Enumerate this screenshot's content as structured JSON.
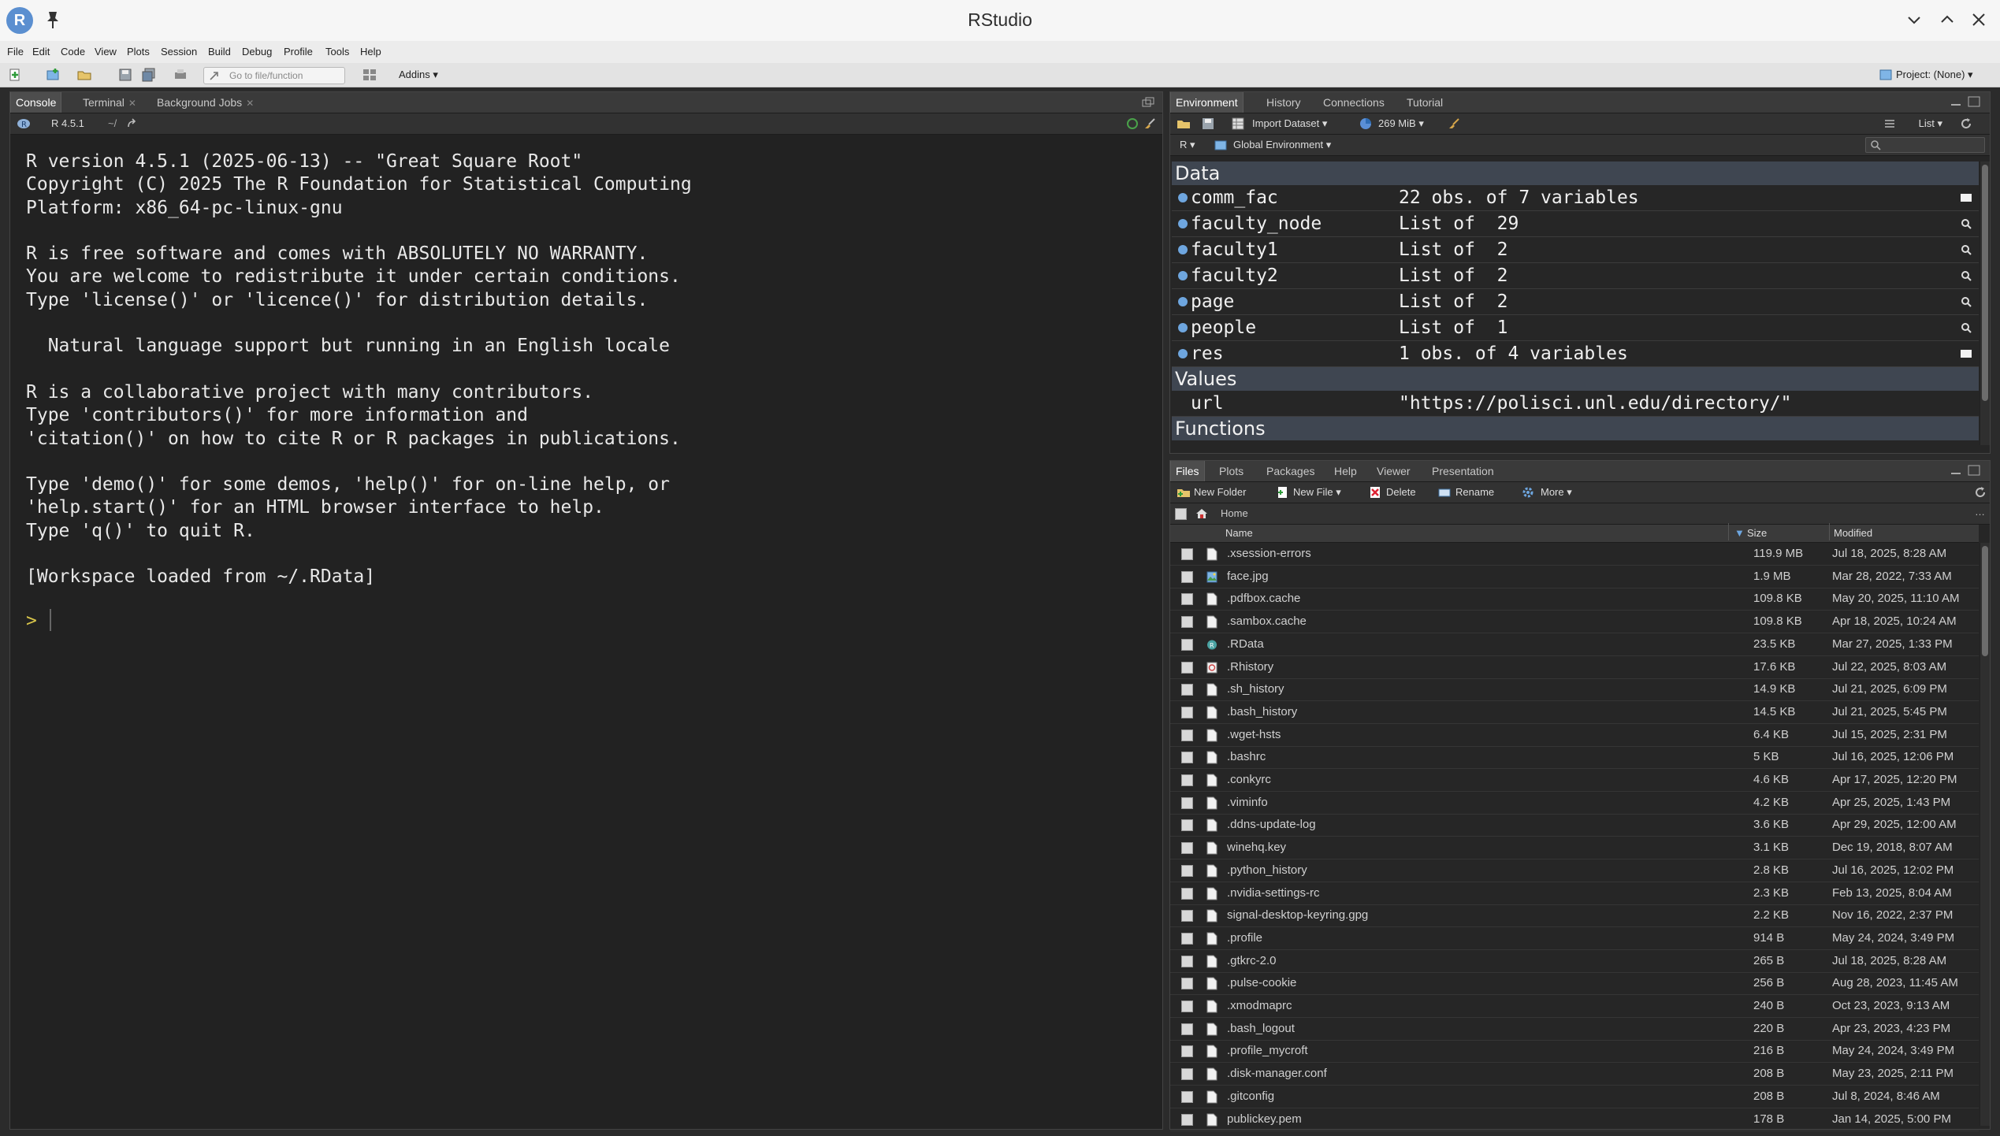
{
  "window": {
    "title": "RStudio",
    "logo_letter": "R"
  },
  "menu": [
    "File",
    "Edit",
    "Code",
    "View",
    "Plots",
    "Session",
    "Build",
    "Debug",
    "Profile",
    "Tools",
    "Help"
  ],
  "toolbar": {
    "goto_placeholder": "Go to file/function",
    "addins": "Addins",
    "project": "Project: (None)"
  },
  "left_pane": {
    "tabs": [
      "Console",
      "Terminal",
      "Background Jobs"
    ],
    "r_version": "R 4.5.1",
    "path": "~/",
    "console_text": "R version 4.5.1 (2025-06-13) -- \"Great Square Root\"\nCopyright (C) 2025 The R Foundation for Statistical Computing\nPlatform: x86_64-pc-linux-gnu\n\nR is free software and comes with ABSOLUTELY NO WARRANTY.\nYou are welcome to redistribute it under certain conditions.\nType 'license()' or 'licence()' for distribution details.\n\n  Natural language support but running in an English locale\n\nR is a collaborative project with many contributors.\nType 'contributors()' for more information and\n'citation()' on how to cite R or R packages in publications.\n\nType 'demo()' for some demos, 'help()' for on-line help, or\n'help.start()' for an HTML browser interface to help.\nType 'q()' to quit R.\n\n[Workspace loaded from ~/.RData]",
    "prompt": ">"
  },
  "env_pane": {
    "tabs": [
      "Environment",
      "History",
      "Connections",
      "Tutorial"
    ],
    "import_dataset": "Import Dataset",
    "memory": "269 MiB",
    "view_mode": "List",
    "language": "R",
    "scope": "Global Environment",
    "sections": {
      "data": "Data",
      "values": "Values",
      "functions": "Functions"
    },
    "data_rows": [
      {
        "name": "comm_fac",
        "value": "22 obs. of 7 variables",
        "action": "grid"
      },
      {
        "name": "faculty_node",
        "value": "List of  29",
        "action": "search"
      },
      {
        "name": "faculty1",
        "value": "List of  2",
        "action": "search"
      },
      {
        "name": "faculty2",
        "value": "List of  2",
        "action": "search"
      },
      {
        "name": "page",
        "value": "List of  2",
        "action": "search"
      },
      {
        "name": "people",
        "value": "List of  1",
        "action": "search"
      },
      {
        "name": "res",
        "value": "1 obs. of 4 variables",
        "action": "grid"
      }
    ],
    "value_rows": [
      {
        "name": "url",
        "value": "\"https://polisci.unl.edu/directory/\""
      }
    ]
  },
  "files_pane": {
    "tabs": [
      "Files",
      "Plots",
      "Packages",
      "Help",
      "Viewer",
      "Presentation"
    ],
    "actions": {
      "new_folder": "New Folder",
      "new_file": "New File",
      "delete": "Delete",
      "rename": "Rename",
      "more": "More"
    },
    "breadcrumb": "Home",
    "columns": {
      "name": "Name",
      "size": "Size",
      "modified": "Modified"
    },
    "files": [
      {
        "name": ".xsession-errors",
        "size": "119.9 MB",
        "modified": "Jul 18, 2025, 8:28 AM",
        "icon": "file"
      },
      {
        "name": "face.jpg",
        "size": "1.9 MB",
        "modified": "Mar 28, 2022, 7:33 AM",
        "icon": "image"
      },
      {
        "name": ".pdfbox.cache",
        "size": "109.8 KB",
        "modified": "May 20, 2025, 11:10 AM",
        "icon": "file"
      },
      {
        "name": ".sambox.cache",
        "size": "109.8 KB",
        "modified": "Apr 18, 2025, 10:24 AM",
        "icon": "file"
      },
      {
        "name": ".RData",
        "size": "23.5 KB",
        "modified": "Mar 27, 2025, 1:33 PM",
        "icon": "rdata"
      },
      {
        "name": ".Rhistory",
        "size": "17.6 KB",
        "modified": "Jul 22, 2025, 8:03 AM",
        "icon": "rhistory"
      },
      {
        "name": ".sh_history",
        "size": "14.9 KB",
        "modified": "Jul 21, 2025, 6:09 PM",
        "icon": "file"
      },
      {
        "name": ".bash_history",
        "size": "14.5 KB",
        "modified": "Jul 21, 2025, 5:45 PM",
        "icon": "file"
      },
      {
        "name": ".wget-hsts",
        "size": "6.4 KB",
        "modified": "Jul 15, 2025, 2:31 PM",
        "icon": "file"
      },
      {
        "name": ".bashrc",
        "size": "5 KB",
        "modified": "Jul 16, 2025, 12:06 PM",
        "icon": "file"
      },
      {
        "name": ".conkyrc",
        "size": "4.6 KB",
        "modified": "Apr 17, 2025, 12:20 PM",
        "icon": "file"
      },
      {
        "name": ".viminfo",
        "size": "4.2 KB",
        "modified": "Apr 25, 2025, 1:43 PM",
        "icon": "file"
      },
      {
        "name": ".ddns-update-log",
        "size": "3.6 KB",
        "modified": "Apr 29, 2025, 12:00 AM",
        "icon": "file"
      },
      {
        "name": "winehq.key",
        "size": "3.1 KB",
        "modified": "Dec 19, 2018, 8:07 AM",
        "icon": "file"
      },
      {
        "name": ".python_history",
        "size": "2.8 KB",
        "modified": "Jul 16, 2025, 12:02 PM",
        "icon": "file"
      },
      {
        "name": ".nvidia-settings-rc",
        "size": "2.3 KB",
        "modified": "Feb 13, 2025, 8:04 AM",
        "icon": "file"
      },
      {
        "name": "signal-desktop-keyring.gpg",
        "size": "2.2 KB",
        "modified": "Nov 16, 2022, 2:37 PM",
        "icon": "file"
      },
      {
        "name": ".profile",
        "size": "914 B",
        "modified": "May 24, 2024, 3:49 PM",
        "icon": "file"
      },
      {
        "name": ".gtkrc-2.0",
        "size": "265 B",
        "modified": "Jul 18, 2025, 8:28 AM",
        "icon": "file"
      },
      {
        "name": ".pulse-cookie",
        "size": "256 B",
        "modified": "Aug 28, 2023, 11:45 AM",
        "icon": "file"
      },
      {
        "name": ".xmodmaprc",
        "size": "240 B",
        "modified": "Oct 23, 2023, 9:13 AM",
        "icon": "file"
      },
      {
        "name": ".bash_logout",
        "size": "220 B",
        "modified": "Apr 23, 2023, 4:23 PM",
        "icon": "file"
      },
      {
        "name": ".profile_mycroft",
        "size": "216 B",
        "modified": "May 24, 2024, 3:49 PM",
        "icon": "file"
      },
      {
        "name": ".disk-manager.conf",
        "size": "208 B",
        "modified": "May 23, 2025, 2:11 PM",
        "icon": "file"
      },
      {
        "name": ".gitconfig",
        "size": "208 B",
        "modified": "Jul 8, 2024, 8:46 AM",
        "icon": "file"
      },
      {
        "name": "publickey.pem",
        "size": "178 B",
        "modified": "Jan 14, 2025, 5:00 PM",
        "icon": "file"
      }
    ]
  }
}
